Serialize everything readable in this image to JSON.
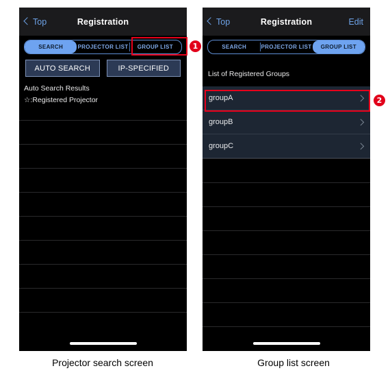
{
  "figure": {
    "captions": {
      "left": "Projector search screen",
      "right": "Group list screen"
    },
    "callouts": [
      {
        "id": 1,
        "label": "1",
        "target": "group-list-tab"
      },
      {
        "id": 2,
        "label": "2",
        "target": "groupA-row"
      }
    ],
    "accent_red": "#e2001a",
    "accent_blue": "#6ea3f0"
  },
  "left_screen": {
    "navbar": {
      "back_label": "Top",
      "title": "Registration",
      "right_action": ""
    },
    "segmented": {
      "options": [
        "SEARCH",
        "PROJECTOR LIST",
        "GROUP LIST"
      ],
      "selected": "SEARCH"
    },
    "buttons": [
      {
        "label": "AUTO SEARCH"
      },
      {
        "label": "IP-SPECIFIED"
      }
    ],
    "labels": [
      "Auto Search Results",
      "☆:Registered Projector"
    ],
    "empty_row_count": 9
  },
  "right_screen": {
    "navbar": {
      "back_label": "Top",
      "title": "Registration",
      "right_action": "Edit"
    },
    "segmented": {
      "options": [
        "SEARCH",
        "PROJECTOR LIST",
        "GROUP LIST"
      ],
      "selected": "GROUP LIST"
    },
    "section_title": "List of Registered Groups",
    "groups": [
      {
        "name": "groupA"
      },
      {
        "name": "groupB"
      },
      {
        "name": "groupC"
      }
    ],
    "empty_row_count": 8
  }
}
